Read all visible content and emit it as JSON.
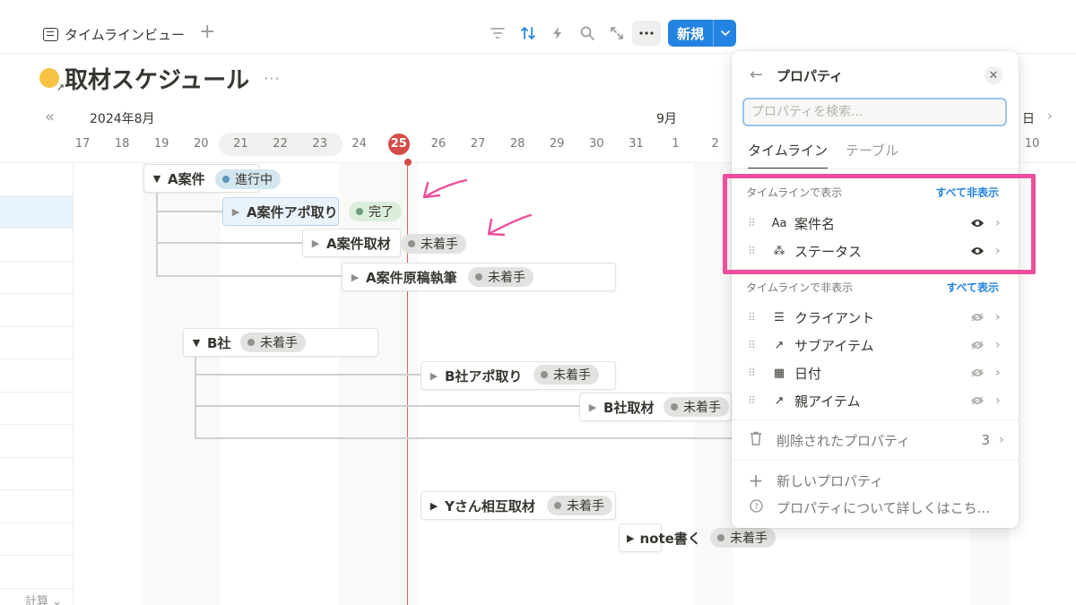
{
  "toolbar": {
    "view_tab": "タイムラインビュー",
    "add_view": "+",
    "new_label": "新規",
    "more_icon": "ellipsis-icon",
    "accent": "#2383e2"
  },
  "page": {
    "title": "取材スケジュール",
    "title_menu": "···"
  },
  "timeline": {
    "collapse": "«",
    "month_1": "2024年8月",
    "month_2": "9月",
    "days": [
      "17",
      "18",
      "19",
      "20",
      "21",
      "22",
      "23",
      "24",
      "25",
      "26",
      "27",
      "28",
      "29",
      "30",
      "31",
      "1",
      "2"
    ],
    "days_right": [
      "10"
    ],
    "month_right_fragment": "日",
    "today": "25",
    "calc_label": "計算 ⌄",
    "today_color": "#d44c47"
  },
  "items": {
    "a_group": {
      "name": "A案件",
      "status": "進行中"
    },
    "a1": {
      "name": "A案件アポ取り",
      "status": "完了"
    },
    "a2": {
      "name": "A案件取材",
      "status": "未着手"
    },
    "a3": {
      "name": "A案件原稿執筆",
      "status": "未着手"
    },
    "b_group": {
      "name": "B社",
      "status": "未着手"
    },
    "b1": {
      "name": "B社アポ取り",
      "status": "未着手"
    },
    "b2": {
      "name": "B社取材",
      "status": "未着手"
    },
    "y1": {
      "name": "Yさん相互取材",
      "status": "未着手"
    },
    "n1": {
      "name": "note書く",
      "status": "未着手"
    }
  },
  "panel": {
    "title": "プロパティ",
    "search_placeholder": "プロパティを検索...",
    "tab_timeline": "タイムライン",
    "tab_table": "テーブル",
    "shown_header": "タイムラインで表示",
    "hide_all": "すべて非表示",
    "shown": [
      {
        "icon": "Aa",
        "label": "案件名"
      },
      {
        "icon": "⁂",
        "label": "ステータス"
      }
    ],
    "hidden_header": "タイムラインで非表示",
    "show_all": "すべて表示",
    "hidden": [
      {
        "icon": "☰",
        "label": "クライアント"
      },
      {
        "icon": "↗",
        "label": "サブアイテム"
      },
      {
        "icon": "▦",
        "label": "日付"
      },
      {
        "icon": "↗",
        "label": "親アイテム"
      }
    ],
    "deleted_label": "削除されたプロパティ",
    "deleted_count": "3",
    "new_property": "新しいプロパティ",
    "learn_more": "プロパティについて詳しくはこち..."
  },
  "annotation_color": "#ec4f9c"
}
